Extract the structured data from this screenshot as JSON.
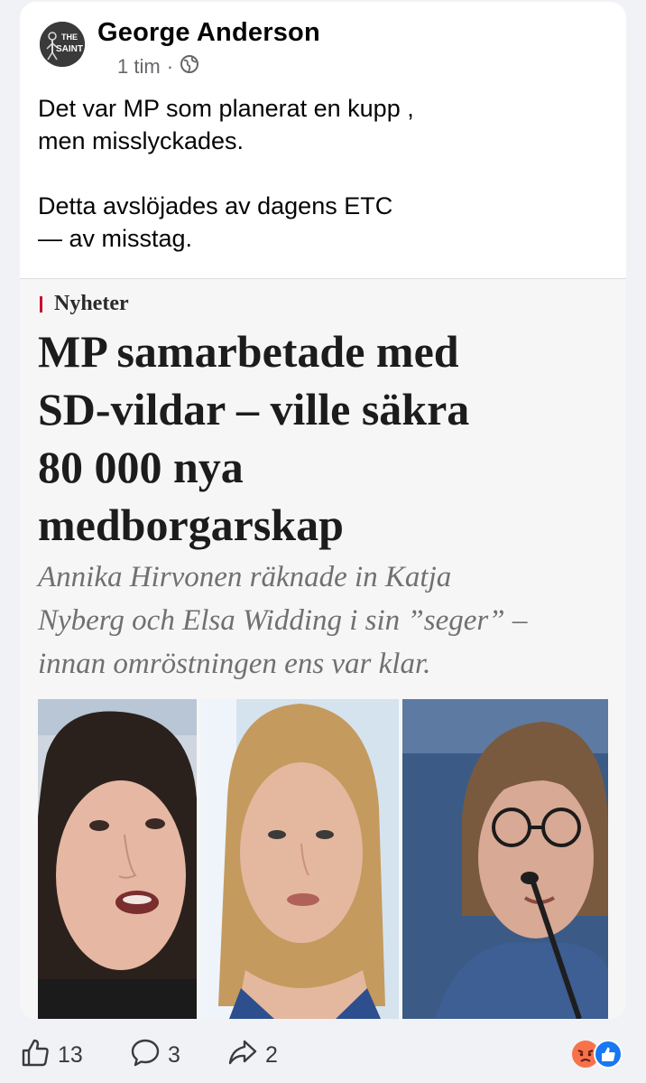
{
  "post": {
    "author": "George Anderson",
    "avatar_text_top": "THE",
    "avatar_text_bottom": "SAINT",
    "time": "1 tim",
    "separator": "·",
    "audience_icon": "globe-icon",
    "text_line1": "Det var MP som planerat en kupp ,",
    "text_line2": "men misslyckades.",
    "text_line3": "Detta avslöjades av dagens ETC",
    "text_line4": "— av misstag."
  },
  "article": {
    "section": "Nyheter",
    "section_bar_color": "#c8102e",
    "headline_line1": "MP samarbetade med",
    "headline_line2": "SD-vildar – ville säkra",
    "headline_line3": "80 000 nya",
    "headline_line4": "medborgarskap",
    "lead_line1": "Annika Hirvonen räknade in Katja",
    "lead_line2": "Nyberg och Elsa Widding i sin ”seger” –",
    "lead_line3": "innan omröstningen ens var klar."
  },
  "actions": {
    "like_icon": "thumbs-up-icon",
    "likes": "13",
    "comment_icon": "comment-icon",
    "comments": "3",
    "share_icon": "share-icon",
    "shares": "2",
    "reaction_icons": [
      "angry-reaction-icon",
      "like-reaction-icon"
    ]
  },
  "colors": {
    "meta_text": "#65676b",
    "like_blue": "#1877f2",
    "angry_orange": "#f7714b"
  }
}
